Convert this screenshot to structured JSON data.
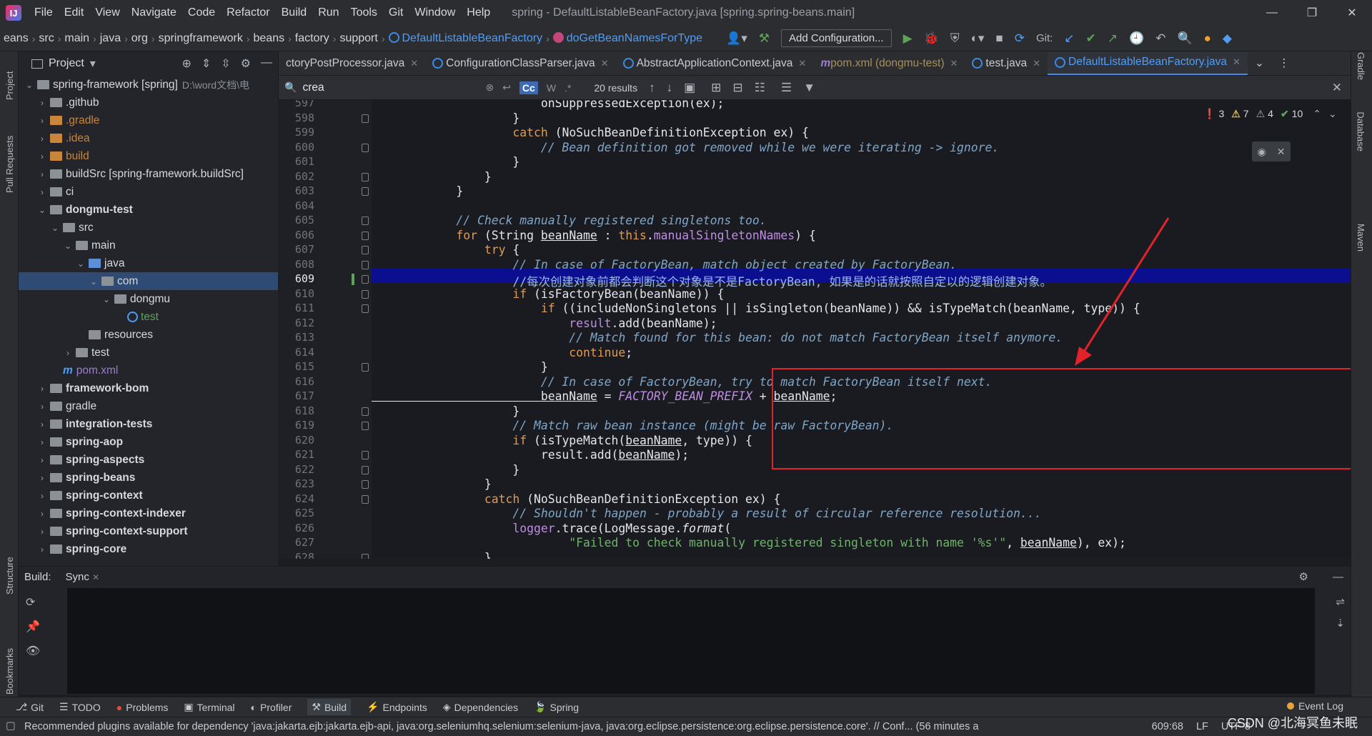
{
  "menubar": {
    "items": [
      "File",
      "Edit",
      "View",
      "Navigate",
      "Code",
      "Refactor",
      "Build",
      "Run",
      "Tools",
      "Git",
      "Window",
      "Help"
    ],
    "title": "spring - DefaultListableBeanFactory.java [spring.spring-beans.main]"
  },
  "navbar": {
    "breadcrumbs": [
      "eans",
      "src",
      "main",
      "java",
      "org",
      "springframework",
      "beans",
      "factory",
      "support"
    ],
    "class_crumb": "DefaultListableBeanFactory",
    "method_crumb": "doGetBeanNamesForType",
    "add_config": "Add Configuration...",
    "git_label": "Git:"
  },
  "leftstrip": {
    "project": "Project",
    "pull_requests": "Pull Requests",
    "structure": "Structure",
    "bookmarks": "Bookmarks"
  },
  "rightstrip": {
    "gradle": "Gradle",
    "database": "Database",
    "maven": "Maven"
  },
  "project": {
    "header": "Project",
    "rows": [
      {
        "label": "spring-framework [spring]",
        "extra": "D:\\word文档\\电",
        "depth": 0,
        "arrow": "down",
        "kind": "folder",
        "bold": false
      },
      {
        "label": ".github",
        "depth": 1,
        "arrow": "right",
        "kind": "folder"
      },
      {
        "label": ".gradle",
        "depth": 1,
        "arrow": "right",
        "kind": "orange"
      },
      {
        "label": ".idea",
        "depth": 1,
        "arrow": "right",
        "kind": "orange"
      },
      {
        "label": "build",
        "depth": 1,
        "arrow": "right",
        "kind": "orange"
      },
      {
        "label": "buildSrc [spring-framework.buildSrc]",
        "depth": 1,
        "arrow": "right",
        "kind": "folder"
      },
      {
        "label": "ci",
        "depth": 1,
        "arrow": "right",
        "kind": "folder"
      },
      {
        "label": "dongmu-test",
        "depth": 1,
        "arrow": "down",
        "kind": "folder",
        "bold": true
      },
      {
        "label": "src",
        "depth": 2,
        "arrow": "down",
        "kind": "folder"
      },
      {
        "label": "main",
        "depth": 3,
        "arrow": "down",
        "kind": "folder"
      },
      {
        "label": "java",
        "depth": 4,
        "arrow": "down",
        "kind": "blue"
      },
      {
        "label": "com",
        "depth": 5,
        "arrow": "down",
        "kind": "folder",
        "selected": true
      },
      {
        "label": "dongmu",
        "depth": 6,
        "arrow": "down",
        "kind": "folder"
      },
      {
        "label": "test",
        "depth": 7,
        "arrow": "",
        "kind": "class"
      },
      {
        "label": "resources",
        "depth": 4,
        "arrow": "",
        "kind": "folder"
      },
      {
        "label": "test",
        "depth": 3,
        "arrow": "right",
        "kind": "folder"
      },
      {
        "label": "pom.xml",
        "depth": 2,
        "arrow": "",
        "kind": "maven"
      },
      {
        "label": "framework-bom",
        "depth": 1,
        "arrow": "right",
        "kind": "folder",
        "bold": true
      },
      {
        "label": "gradle",
        "depth": 1,
        "arrow": "right",
        "kind": "folder"
      },
      {
        "label": "integration-tests",
        "depth": 1,
        "arrow": "right",
        "kind": "folder",
        "bold": true
      },
      {
        "label": "spring-aop",
        "depth": 1,
        "arrow": "right",
        "kind": "folder",
        "bold": true
      },
      {
        "label": "spring-aspects",
        "depth": 1,
        "arrow": "right",
        "kind": "folder",
        "bold": true
      },
      {
        "label": "spring-beans",
        "depth": 1,
        "arrow": "right",
        "kind": "folder",
        "bold": true
      },
      {
        "label": "spring-context",
        "depth": 1,
        "arrow": "right",
        "kind": "folder",
        "bold": true
      },
      {
        "label": "spring-context-indexer",
        "depth": 1,
        "arrow": "right",
        "kind": "folder",
        "bold": true
      },
      {
        "label": "spring-context-support",
        "depth": 1,
        "arrow": "right",
        "kind": "folder",
        "bold": true
      },
      {
        "label": "spring-core",
        "depth": 1,
        "arrow": "right",
        "kind": "folder",
        "bold": true
      }
    ]
  },
  "tabs": [
    {
      "label": "ctoryPostProcessor.java",
      "kind": "plain"
    },
    {
      "label": "ConfigurationClassParser.java",
      "kind": "class"
    },
    {
      "label": "AbstractApplicationContext.java",
      "kind": "class"
    },
    {
      "label": "pom.xml (dongmu-test)",
      "kind": "pom"
    },
    {
      "label": "test.java",
      "kind": "class"
    },
    {
      "label": "DefaultListableBeanFactory.java",
      "kind": "active"
    }
  ],
  "find": {
    "query": "crea",
    "case_label": "Cc",
    "word_label": "W",
    "regex_label": ".*",
    "results": "20 results"
  },
  "inspection": {
    "errors": "3",
    "warnings": "7",
    "weak": "4",
    "ok": "10"
  },
  "editor": {
    "first_line": 597,
    "current_line": 609,
    "lines": [
      [
        [
          "",
          "\t\t\t\t\t\tonSuppressedException(ex);"
        ]
      ],
      [
        [
          "",
          "\t\t\t\t\t}"
        ]
      ],
      [
        [
          "kw",
          "\t\t\t\t\tcatch "
        ],
        [
          "",
          "(NoSuchBeanDefinitionException ex) {"
        ]
      ],
      [
        [
          "cm",
          "\t\t\t\t\t\t// Bean definition got removed while we were iterating -> ignore."
        ]
      ],
      [
        [
          "",
          "\t\t\t\t\t}"
        ]
      ],
      [
        [
          "",
          "\t\t\t\t}"
        ]
      ],
      [
        [
          "",
          "\t\t\t}"
        ]
      ],
      [
        [
          "",
          ""
        ]
      ],
      [
        [
          "cm",
          "\t\t\t// Check manually registered singletons too."
        ]
      ],
      [
        [
          "kw",
          "\t\t\tfor "
        ],
        [
          "",
          "(String "
        ],
        [
          "ul",
          "beanName"
        ],
        [
          "",
          " : "
        ],
        [
          "kw",
          "this"
        ],
        [
          "",
          "."
        ],
        [
          "fld",
          "manualSingletonNames"
        ],
        [
          "",
          ") {"
        ]
      ],
      [
        [
          "kw",
          "\t\t\t\ttry "
        ],
        [
          "",
          "{"
        ]
      ],
      [
        [
          "cm",
          "\t\t\t\t\t// In case of FactoryBean, match object created by FactoryBean."
        ]
      ],
      [
        [
          "cmc",
          "\t\t\t\t\t//每次创建对象前都会判断这个对象是不是FactoryBean, 如果是的话就按照自定以的逻辑创建对象。"
        ]
      ],
      [
        [
          "kw",
          "\t\t\t\t\tif "
        ],
        [
          "",
          "(isFactoryBean(beanName)) {"
        ]
      ],
      [
        [
          "kw",
          "\t\t\t\t\t\tif "
        ],
        [
          "",
          "((includeNonSingletons || isSingleton(beanName)) && isTypeMatch(beanName, type)) {"
        ]
      ],
      [
        [
          "fld",
          "\t\t\t\t\t\t\tresult"
        ],
        [
          "",
          ".add(beanName);"
        ]
      ],
      [
        [
          "cm",
          "\t\t\t\t\t\t\t// Match found for this bean: do not match FactoryBean itself anymore."
        ]
      ],
      [
        [
          "kw",
          "\t\t\t\t\t\t\tcontinue"
        ],
        [
          "",
          ";"
        ]
      ],
      [
        [
          "",
          "\t\t\t\t\t\t}"
        ]
      ],
      [
        [
          "cm",
          "\t\t\t\t\t\t// In case of FactoryBean, try to match FactoryBean itself next."
        ]
      ],
      [
        [
          "ul",
          "\t\t\t\t\t\tbeanName"
        ],
        [
          "",
          " = "
        ],
        [
          "const",
          "FACTORY_BEAN_PREFIX"
        ],
        [
          "",
          " + "
        ],
        [
          "ul",
          "beanName"
        ],
        [
          "",
          ";"
        ]
      ],
      [
        [
          "",
          "\t\t\t\t\t}"
        ]
      ],
      [
        [
          "cm",
          "\t\t\t\t\t// Match raw bean instance (might be raw FactoryBean)."
        ]
      ],
      [
        [
          "kw",
          "\t\t\t\t\tif "
        ],
        [
          "",
          "(isTypeMatch("
        ],
        [
          "ul",
          "beanName"
        ],
        [
          "",
          ", type)) {"
        ]
      ],
      [
        [
          "",
          "\t\t\t\t\t\tresult.add("
        ],
        [
          "ul",
          "beanName"
        ],
        [
          "",
          ");"
        ]
      ],
      [
        [
          "",
          "\t\t\t\t\t}"
        ]
      ],
      [
        [
          "",
          "\t\t\t\t}"
        ]
      ],
      [
        [
          "kw",
          "\t\t\t\tcatch "
        ],
        [
          "",
          "(NoSuchBeanDefinitionException ex) {"
        ]
      ],
      [
        [
          "cm",
          "\t\t\t\t\t// Shouldn't happen - probably a result of circular reference resolution..."
        ]
      ],
      [
        [
          "fld",
          "\t\t\t\t\tlogger"
        ],
        [
          "",
          ".trace(LogMessage."
        ],
        [
          "fn",
          "format"
        ],
        [
          "",
          "("
        ]
      ],
      [
        [
          "str",
          "\t\t\t\t\t\t\t\"Failed to check manually registered singleton with name '%s'\""
        ],
        [
          "",
          ", "
        ],
        [
          "ul",
          "beanName"
        ],
        [
          "",
          "), ex);"
        ]
      ],
      [
        [
          "",
          "\t\t\t\t}"
        ]
      ],
      [
        [
          "",
          ""
        ]
      ]
    ]
  },
  "build": {
    "label": "Build:",
    "sync": "Sync"
  },
  "toolwindows": [
    "Git",
    "TODO",
    "Problems",
    "Terminal",
    "Profiler",
    "Build",
    "Endpoints",
    "Dependencies",
    "Spring"
  ],
  "event_log": "Event Log",
  "status": {
    "message": "Recommended plugins available for dependency 'java:jakarta.ejb:jakarta.ejb-api, java:org.seleniumhq.selenium:selenium-java, java:org.eclipse.persistence:org.eclipse.persistence.core'. // Conf... (56 minutes a",
    "position": "609:68",
    "line_sep": "LF",
    "encoding": "UTF-8"
  },
  "watermark": "CSDN @北海冥鱼未眠"
}
